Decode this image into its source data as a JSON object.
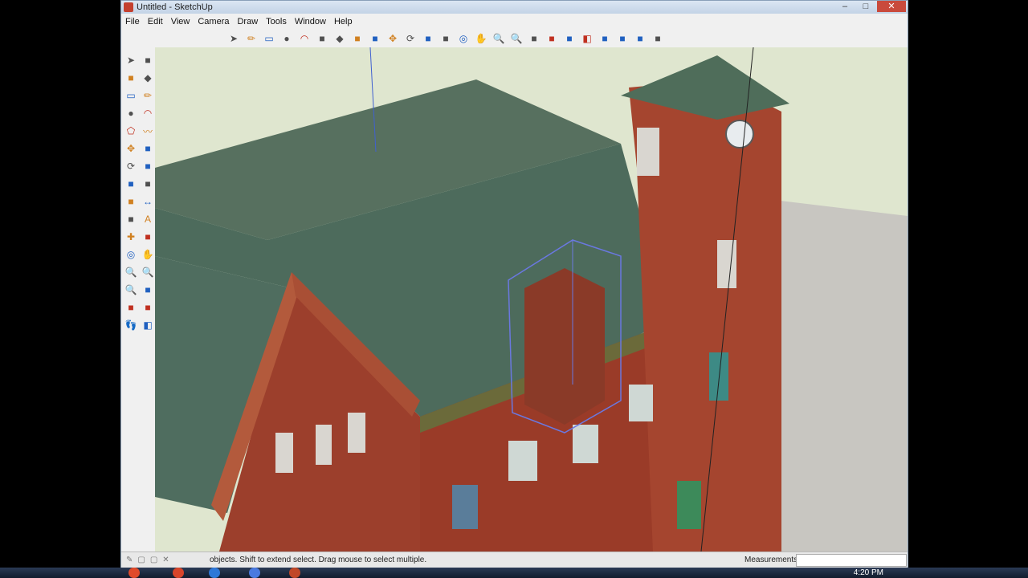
{
  "window": {
    "title": "Untitled - SketchUp",
    "controls": [
      "–",
      "□",
      "✕"
    ]
  },
  "menus": [
    "File",
    "Edit",
    "View",
    "Camera",
    "Draw",
    "Tools",
    "Window",
    "Help"
  ],
  "toolbar_icons": [
    "select-icon",
    "line-icon",
    "rectangle-icon",
    "circle-icon",
    "arc-icon",
    "make-component-icon",
    "eraser-icon",
    "paint-bucket-icon",
    "push-pull-icon",
    "move-icon",
    "rotate-icon",
    "scale-icon",
    "offset-icon",
    "orbit-icon",
    "pan-icon",
    "zoom-icon",
    "zoom-extents-icon",
    "get-models-icon",
    "share-model-icon",
    "component-icon",
    "section-icon",
    "warehouse-icon",
    "photo-texture-icon",
    "extension-icon",
    "layers-icon"
  ],
  "left_tools": [
    "select-icon",
    "make-component-icon",
    "paint-bucket-icon",
    "eraser-icon",
    "rectangle-icon",
    "line-icon",
    "circle-icon",
    "arc-icon",
    "polygon-icon",
    "freehand-icon",
    "move-icon",
    "push-pull-icon",
    "rotate-icon",
    "follow-me-icon",
    "scale-icon",
    "offset-icon",
    "tape-measure-icon",
    "dimension-icon",
    "protractor-icon",
    "text-icon",
    "axes-icon",
    "3d-text-icon",
    "orbit-icon",
    "pan-icon",
    "zoom-icon",
    "zoom-window-icon",
    "zoom-extents-icon",
    "previous-view-icon",
    "position-camera-icon",
    "look-around-icon",
    "walk-icon",
    "section-plane-icon"
  ],
  "status": {
    "text": "objects. Shift to extend select. Drag mouse to select multiple.",
    "measurements_label": "Measurements"
  },
  "taskbar": {
    "time": "4:20 PM"
  },
  "colors": {
    "roof": "#4d6b5c",
    "brick": "#9c3f2c",
    "sky": "#dfe6cf",
    "selection": "#6a78e0"
  }
}
